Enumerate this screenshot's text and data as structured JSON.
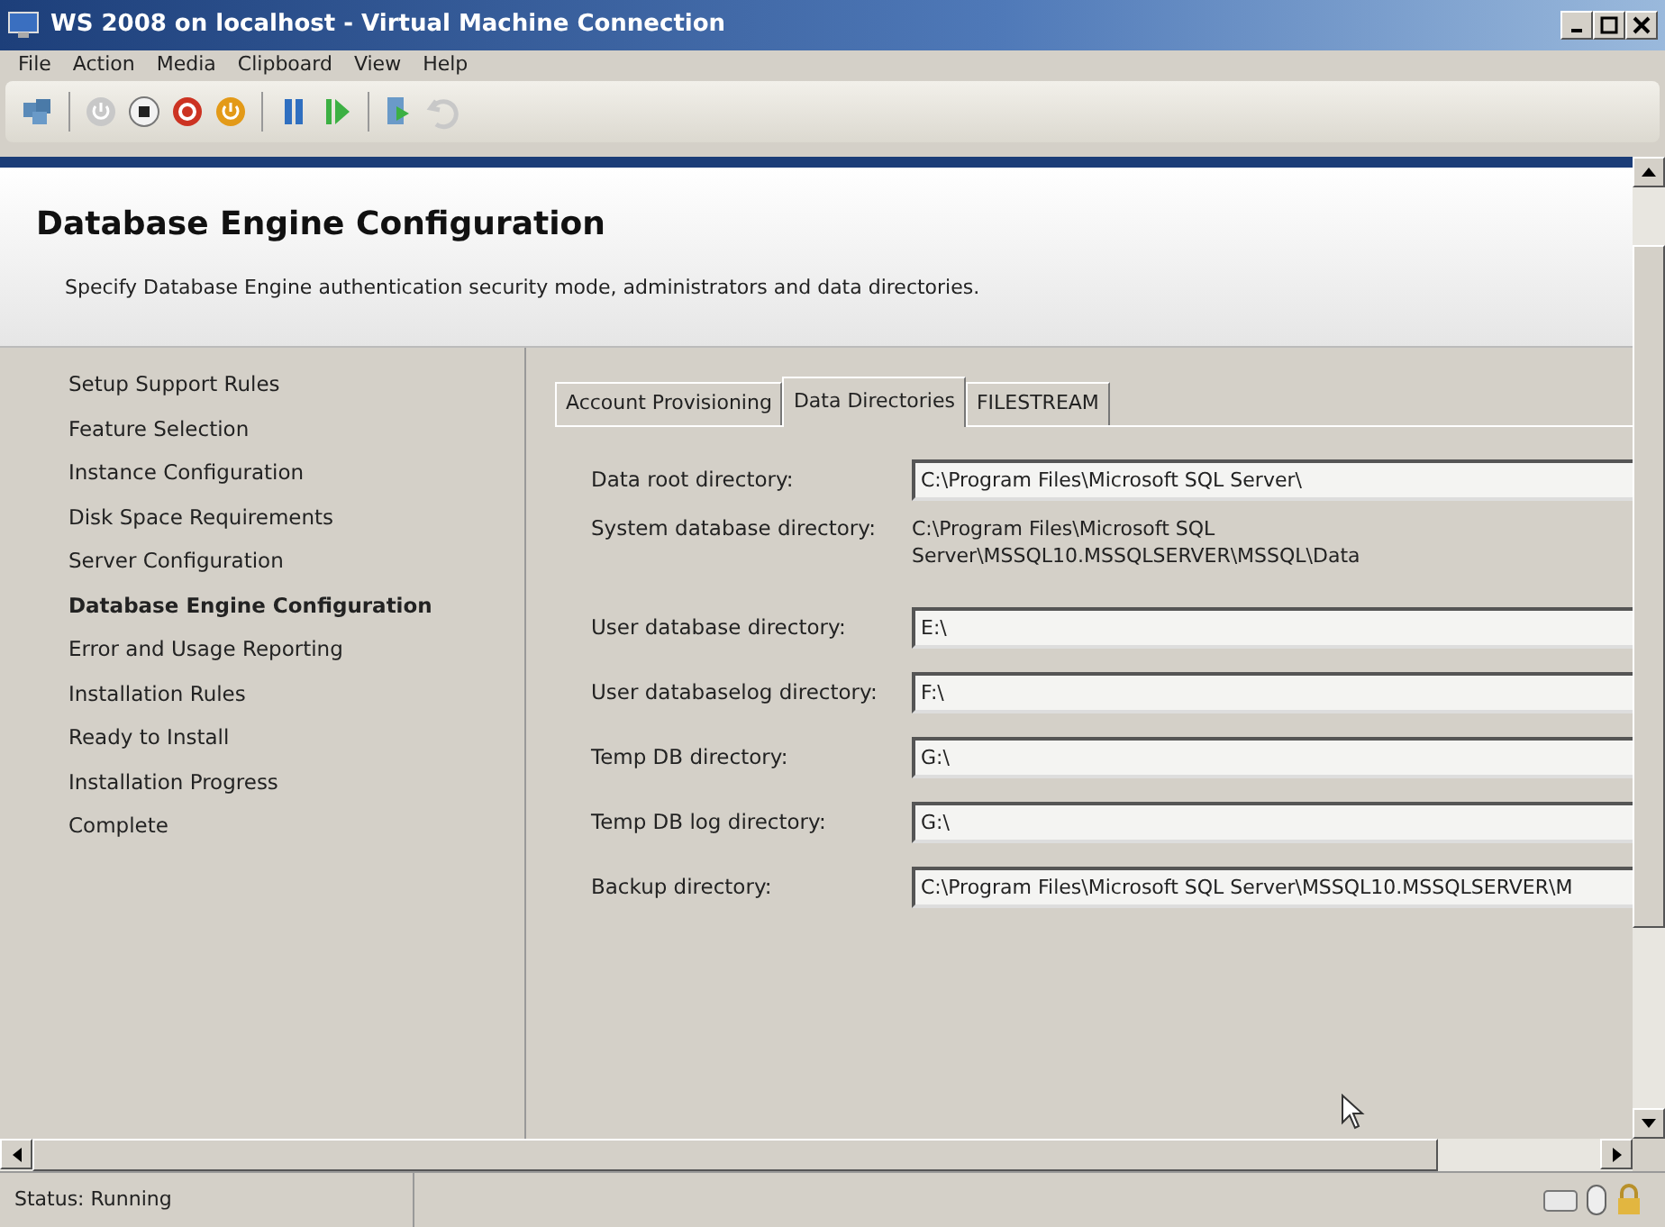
{
  "window": {
    "title": "WS 2008 on localhost - Virtual Machine Connection"
  },
  "menu": [
    "File",
    "Action",
    "Media",
    "Clipboard",
    "View",
    "Help"
  ],
  "toolbar": [
    {
      "kind": "ctrl-alt-del"
    },
    {
      "kind": "sep"
    },
    {
      "kind": "start",
      "disabled": true
    },
    {
      "kind": "turn-off",
      "disabled": false
    },
    {
      "kind": "shutdown",
      "disabled": false
    },
    {
      "kind": "power",
      "disabled": false
    },
    {
      "kind": "sep"
    },
    {
      "kind": "pause",
      "disabled": false
    },
    {
      "kind": "resume",
      "disabled": false
    },
    {
      "kind": "sep"
    },
    {
      "kind": "snapshot",
      "disabled": false
    },
    {
      "kind": "revert",
      "disabled": true
    }
  ],
  "header": {
    "title": "Database Engine Configuration",
    "subtitle": "Specify Database Engine authentication security mode, administrators and data directories."
  },
  "steps": [
    {
      "label": "Setup Support Rules",
      "selected": false
    },
    {
      "label": "Feature Selection",
      "selected": false
    },
    {
      "label": "Instance Configuration",
      "selected": false
    },
    {
      "label": "Disk Space Requirements",
      "selected": false
    },
    {
      "label": "Server Configuration",
      "selected": false
    },
    {
      "label": "Database Engine Configuration",
      "selected": true
    },
    {
      "label": "Error and Usage Reporting",
      "selected": false
    },
    {
      "label": "Installation Rules",
      "selected": false
    },
    {
      "label": "Ready to Install",
      "selected": false
    },
    {
      "label": "Installation Progress",
      "selected": false
    },
    {
      "label": "Complete",
      "selected": false
    }
  ],
  "tabs": [
    {
      "label": "Account Provisioning",
      "selected": false
    },
    {
      "label": "Data Directories",
      "selected": true
    },
    {
      "label": "FILESTREAM",
      "selected": false
    }
  ],
  "fields": [
    {
      "kind": "input",
      "label": "Data root directory:",
      "value": "C:\\Program Files\\Microsoft SQL Server\\"
    },
    {
      "kind": "text",
      "label": "System database directory:",
      "value": "C:\\Program Files\\Microsoft SQL Server\\MSSQL10.MSSQLSERVER\\MSSQL\\Data"
    },
    {
      "kind": "input",
      "label": "User database directory:",
      "value": "E:\\"
    },
    {
      "kind": "input",
      "label": "User databaselog directory:",
      "value": "F:\\"
    },
    {
      "kind": "input",
      "label": "Temp DB directory:",
      "value": "G:\\"
    },
    {
      "kind": "input",
      "label": "Temp DB log directory:",
      "value": "G:\\"
    },
    {
      "kind": "input",
      "label": "Backup directory:",
      "value": "C:\\Program Files\\Microsoft SQL Server\\MSSQL10.MSSQLSERVER\\M"
    }
  ],
  "status_bar": {
    "text": "Status: Running"
  }
}
